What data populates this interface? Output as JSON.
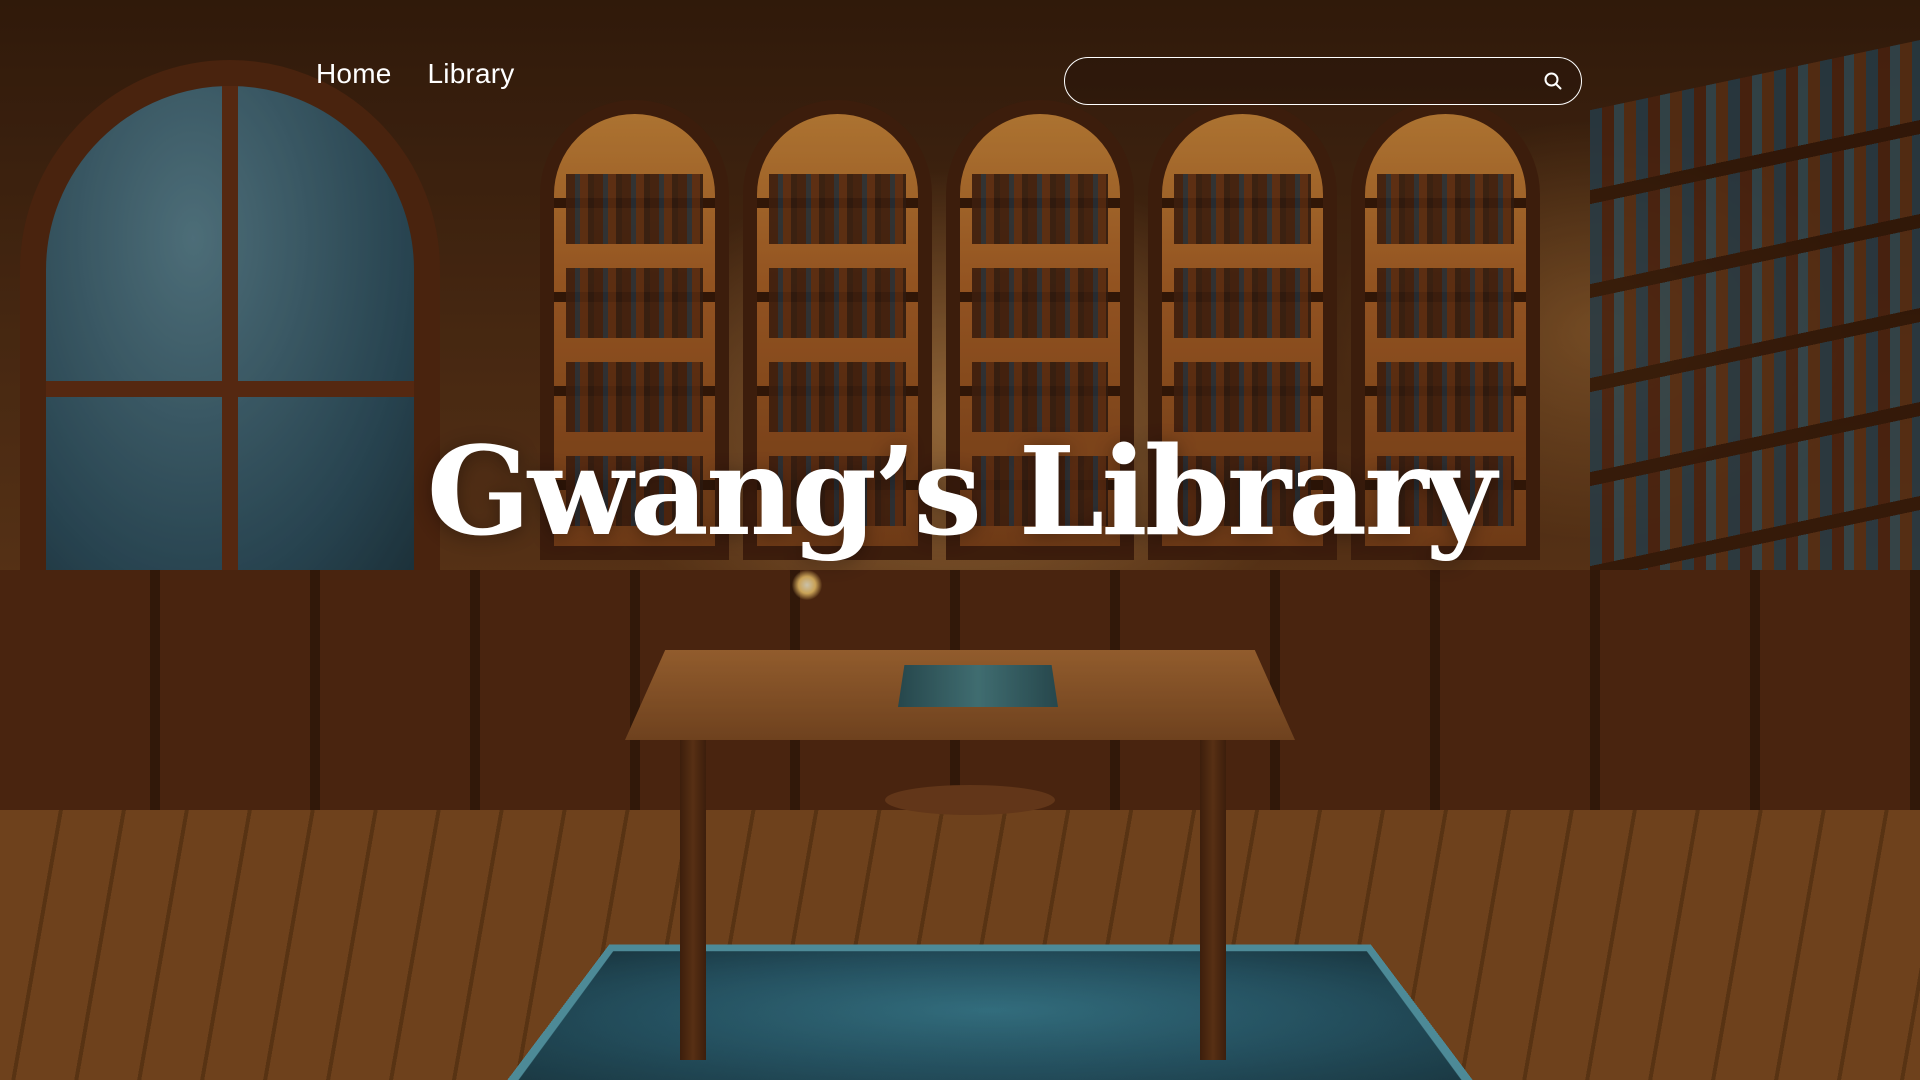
{
  "nav": {
    "items": [
      {
        "label": "Home"
      },
      {
        "label": "Library"
      }
    ]
  },
  "search": {
    "value": "",
    "placeholder": "",
    "icon": "search-icon"
  },
  "hero": {
    "title": "Gwang’s Library",
    "background": "cozy-library-illustration"
  },
  "colors": {
    "text": "#ffffff",
    "search_border": "#ffffff"
  }
}
